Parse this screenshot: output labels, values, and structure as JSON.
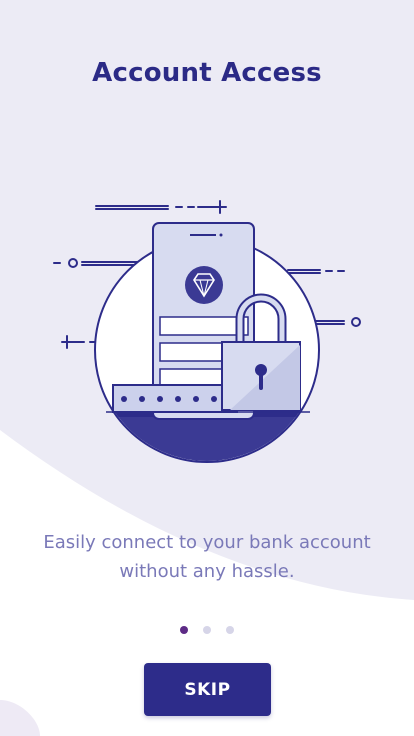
{
  "onboarding": {
    "title": "Account Access",
    "subtitle_line1": "Easily connect to your bank account",
    "subtitle_line2": "without any hassle.",
    "page_indicator": {
      "total": 3,
      "current": 1
    },
    "skip_label": "SKIP"
  },
  "colors": {
    "primary": "#2d2c8a",
    "title": "#2b2a86",
    "subtitle": "#7a79b8",
    "active_dot": "#5d2b86",
    "inactive_dot": "#d6d5e8",
    "background": "#ecebf5"
  },
  "icons": [
    "diamond-logo-icon",
    "padlock-icon",
    "phone-illustration"
  ]
}
